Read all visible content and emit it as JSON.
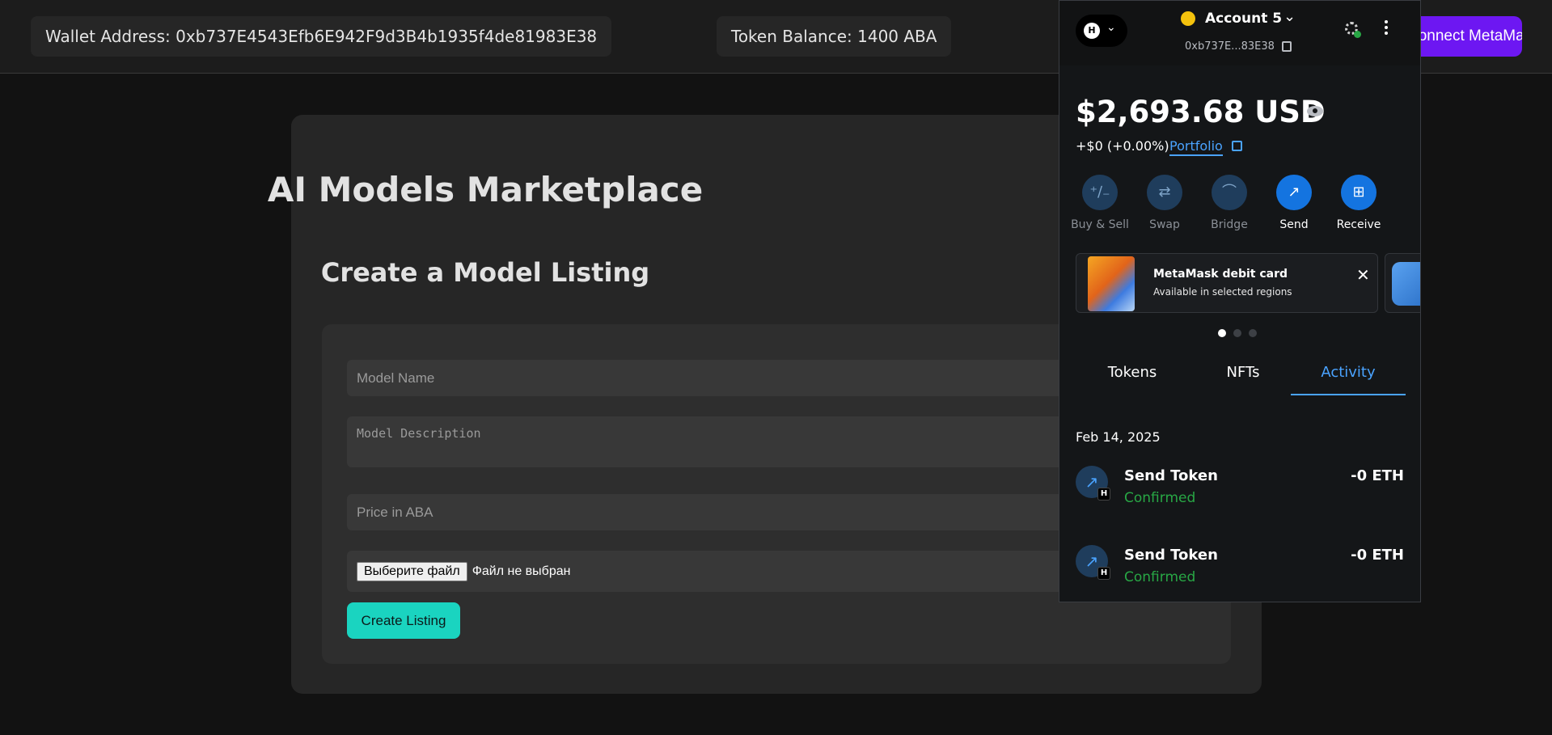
{
  "topbar": {
    "wallet_label": "Wallet Address: 0xb737E4543Efb6E942F9d3B4b1935f4de81983E38",
    "balance_label": "Token Balance: 1400 ABA",
    "connect_label": "Connect MetaMask"
  },
  "main": {
    "title": "AI Models Marketplace",
    "subtitle": "Create a Model Listing",
    "form": {
      "name_placeholder": "Model Name",
      "description_placeholder": "Model Description",
      "price_placeholder": "Price in ABA",
      "file_button": "Выберите файл",
      "file_status": "Файл не выбран",
      "submit_label": "Create Listing"
    }
  },
  "metamask": {
    "network_avatar": "H",
    "account_name": "Account 5",
    "account_address": "0xb737E...83E38",
    "balance": "$2,693.68 USD",
    "change": "+$0 (+0.00%)",
    "portfolio_label": "Portfolio",
    "actions": [
      {
        "label": "Buy & Sell",
        "icon": "buy-sell-icon",
        "glyph": "⁺∕₋"
      },
      {
        "label": "Swap",
        "icon": "swap-icon",
        "glyph": "⇄"
      },
      {
        "label": "Bridge",
        "icon": "bridge-icon",
        "glyph": "⌒"
      },
      {
        "label": "Send",
        "icon": "send-icon",
        "glyph": "↗"
      },
      {
        "label": "Receive",
        "icon": "receive-icon",
        "glyph": "⊞"
      }
    ],
    "promo": {
      "title": "MetaMask debit card",
      "subtitle": "Available in selected regions"
    },
    "tabs": [
      "Tokens",
      "NFTs",
      "Activity"
    ],
    "active_tab": "Activity",
    "activity_date": "Feb 14, 2025",
    "transactions": [
      {
        "title": "Send Token",
        "status": "Confirmed",
        "amount": "-0 ETH",
        "badge": "H"
      },
      {
        "title": "Send Token",
        "status": "Confirmed",
        "amount": "-0 ETH",
        "badge": "H"
      }
    ]
  },
  "colors": {
    "accent_purple": "#6d17f2",
    "accent_teal": "#1ad4c0",
    "metamask_blue": "#4aa3ff",
    "confirmed_green": "#28a745"
  }
}
